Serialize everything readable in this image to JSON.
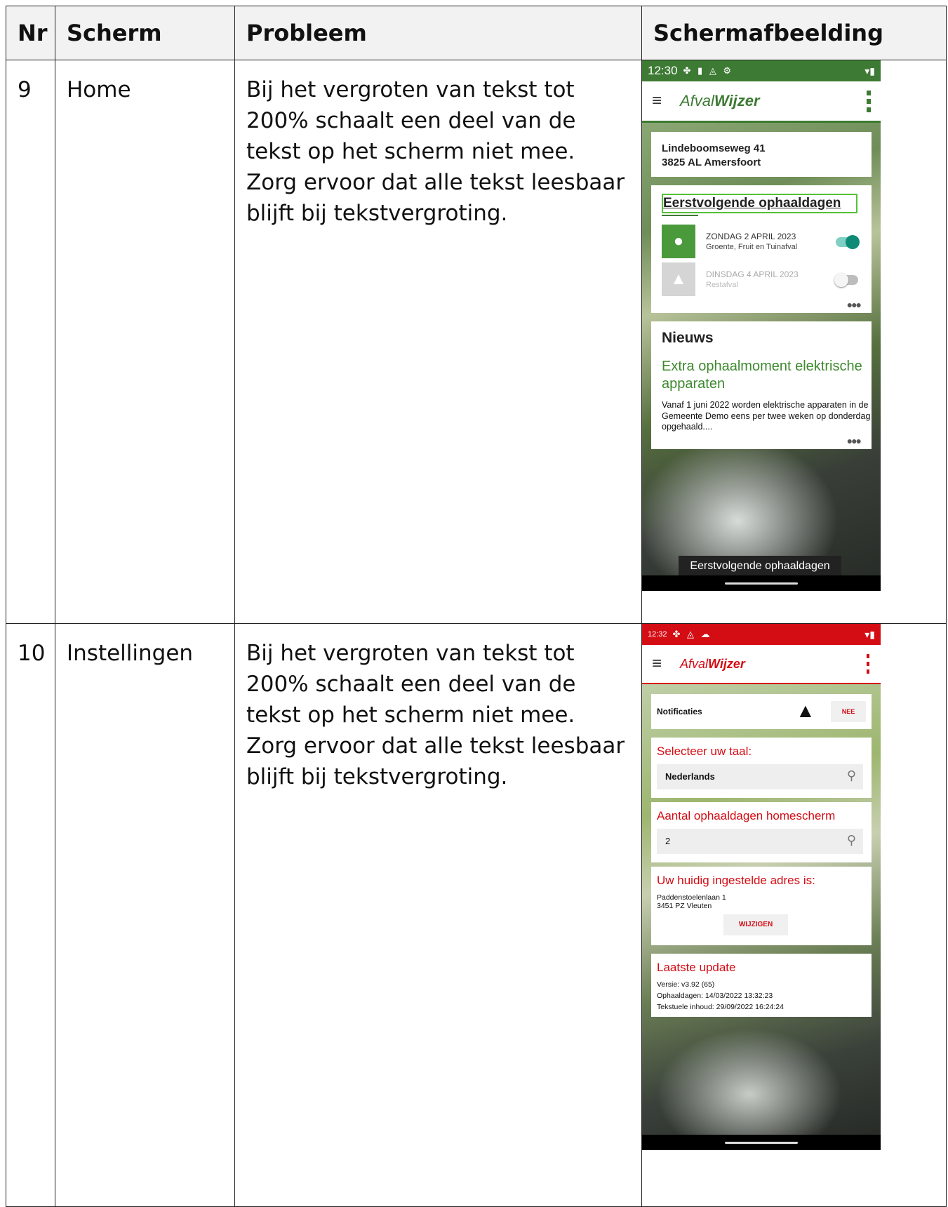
{
  "table": {
    "headers": {
      "nr": "Nr",
      "scherm": "Scherm",
      "probleem": "Probleem",
      "afbeelding": "Schermafbeelding"
    },
    "rows": [
      {
        "nr": "9",
        "scherm": "Home",
        "probleem": "Bij het vergroten van tekst tot 200% schaalt een deel van de tekst op het scherm niet mee. Zorg ervoor dat alle tekst leesbaar blijft bij tekstvergroting."
      },
      {
        "nr": "10",
        "scherm": "Instellingen",
        "probleem": "Bij het vergroten van tekst tot 200% schaalt een deel van de tekst op het scherm niet mee. Zorg ervoor dat alle tekst leesbaar blijft bij tekstvergroting."
      }
    ]
  },
  "phone_home": {
    "time": "12:30",
    "status_icons": "✤ ▮ ◬ ⚙",
    "logo_light": "Afval",
    "logo_bold": "Wijzer",
    "address_line1": "Lindeboomseweg 41",
    "address_line2": "3825 AL Amersfoort",
    "pickups_title": "Eerstvolgende ophaaldagen",
    "pickups": [
      {
        "date": "ZONDAG 2 APRIL 2023",
        "type": "Groente, Fruit en Tuinafval",
        "enabled": true
      },
      {
        "date": "DINSDAG 4 APRIL 2023",
        "type": "Restafval",
        "enabled": false
      }
    ],
    "news_heading": "Nieuws",
    "news_title": "Extra ophaalmoment elektrische apparaten",
    "news_body": "Vanaf 1 juni 2022 worden elektrische apparaten in de Gemeente Demo eens per twee weken op donderdag opgehaald....",
    "toast": "Eerstvolgende ophaaldagen",
    "colors": {
      "brand": "#3d7a33"
    }
  },
  "phone_settings": {
    "time": "12:32",
    "logo_light": "Afval",
    "logo_bold": "Wijzer",
    "notifications_label": "Notificaties",
    "notifications_button": "NEE",
    "language_title": "Selecteer uw taal:",
    "language_value": "Nederlands",
    "count_title": "Aantal ophaaldagen homescherm",
    "count_value": "2",
    "address_title": "Uw huidig ingestelde adres is:",
    "address_line1": "Paddenstoelenlaan 1",
    "address_line2": "3451 PZ Vleuten",
    "change_button": "WIJZIGEN",
    "update_title": "Laatste update",
    "version": "Versie: v3.92 (65)",
    "pickup_dates": "Ophaaldagen: 14/03/2022 13:32:23",
    "text_content": "Tekstuele inhoud: 29/09/2022 16:24:24",
    "colors": {
      "brand": "#d40c14"
    }
  }
}
